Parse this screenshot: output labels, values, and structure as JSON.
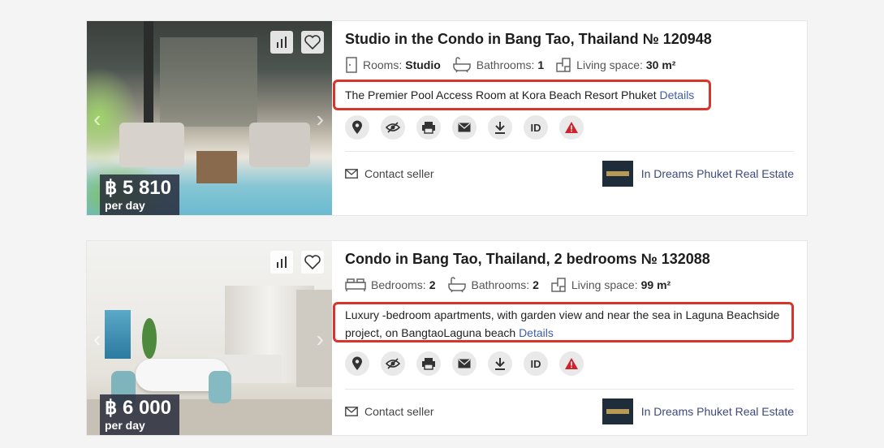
{
  "listings": [
    {
      "title": "Studio in the Condo in Bang Tao, Thailand № 120948",
      "features": [
        {
          "icon": "door-icon",
          "label": "Rooms:",
          "value": "Studio"
        },
        {
          "icon": "bathtub-icon",
          "label": "Bathrooms:",
          "value": "1"
        },
        {
          "icon": "floorplan-icon",
          "label": "Living space:",
          "value": "30 m²"
        }
      ],
      "description": "The Premier Pool Access Room at Kora Beach Resort Phuket",
      "details_link": "Details",
      "price": "฿ 5 810",
      "price_unit": "per day",
      "actions": [
        "location-icon",
        "hide-icon",
        "print-icon",
        "email-icon",
        "download-icon",
        "ID",
        "report-icon"
      ],
      "contact": "Contact seller",
      "agency": "In Dreams Phuket Real Estate"
    },
    {
      "title": "Condo in Bang Tao, Thailand, 2 bedrooms № 132088",
      "features": [
        {
          "icon": "bed-icon",
          "label": "Bedrooms:",
          "value": "2"
        },
        {
          "icon": "bathtub-icon",
          "label": "Bathrooms:",
          "value": "2"
        },
        {
          "icon": "floorplan-icon",
          "label": "Living space:",
          "value": "99 m²"
        }
      ],
      "description": "Luxury -bedroom apartments, with garden view and near the sea in Laguna Beachside project, on BangtaoLaguna beach",
      "details_link": "Details",
      "price": "฿ 6 000",
      "price_unit": "per day",
      "actions": [
        "location-icon",
        "hide-icon",
        "print-icon",
        "email-icon",
        "download-icon",
        "ID",
        "report-icon"
      ],
      "contact": "Contact seller",
      "agency": "In Dreams Phuket Real Estate"
    }
  ],
  "colors": {
    "highlight_border": "#d9342b",
    "link": "#3f5ea8",
    "agency_text": "#3e4a7a",
    "report": "#d0212a"
  }
}
